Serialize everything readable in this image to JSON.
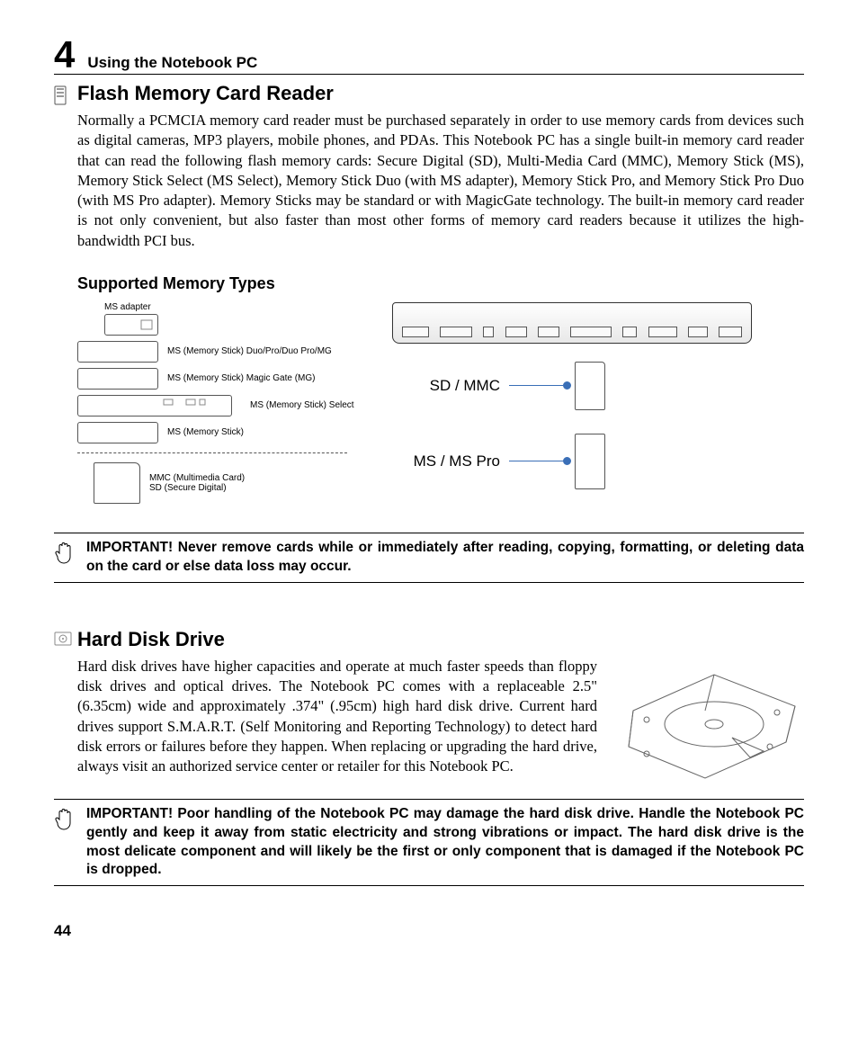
{
  "chapter": {
    "number": "4",
    "title": "Using the Notebook PC"
  },
  "section1": {
    "heading": "Flash Memory Card Reader",
    "body": "Normally a PCMCIA memory card reader must be purchased separately in order to use memory cards from devices such as digital cameras, MP3 players, mobile phones, and PDAs. This Notebook PC has a single built-in memory card reader that can read the following flash memory cards: Secure Digital (SD), Multi-Media Card (MMC), Memory Stick (MS), Memory Stick Select (MS Select), Memory Stick Duo (with MS adapter), Memory Stick Pro, and Memory Stick Pro Duo (with MS Pro adapter). Memory Sticks may be standard or with MagicGate technology. The built-in memory card reader is not only convenient, but also faster than most other forms of memory card readers because it utilizes the high-bandwidth PCI bus.",
    "subheading": "Supported Memory Types",
    "left_labels": {
      "ms_adapter": "MS adapter",
      "ms1": "MS (Memory Stick) Duo/Pro/Duo Pro/MG",
      "ms2": "MS (Memory Stick) Magic Gate (MG)",
      "ms3": "MS (Memory Stick) Select",
      "ms4": "MS (Memory Stick)",
      "sd_mmc": "MMC (Multimedia Card)\nSD (Secure Digital)"
    },
    "right_labels": {
      "sd": "SD / MMC",
      "ms": "MS / MS Pro"
    },
    "important": "IMPORTANT!  Never remove cards while or immediately after reading, copying, formatting, or deleting data on the card or else data loss may occur."
  },
  "section2": {
    "heading": "Hard Disk Drive",
    "body": "Hard disk drives have higher capacities and operate at much faster speeds than floppy disk drives and optical drives. The Notebook PC comes with a replaceable 2.5\" (6.35cm) wide and approximately .374\" (.95cm) high hard disk drive. Current hard drives support S.M.A.R.T. (Self Monitoring and Reporting Technology) to detect hard disk errors or failures before they happen. When replacing or upgrading the hard drive, always visit an authorized service center or retailer for this Notebook PC.",
    "important": "IMPORTANT!  Poor handling of the Notebook PC may damage the hard disk drive. Handle the Notebook PC gently and keep it away from static electricity and strong vibrations or impact. The hard disk drive is the most delicate component and will likely be the first or only component that is damaged if the Notebook PC is dropped."
  },
  "page_number": "44"
}
